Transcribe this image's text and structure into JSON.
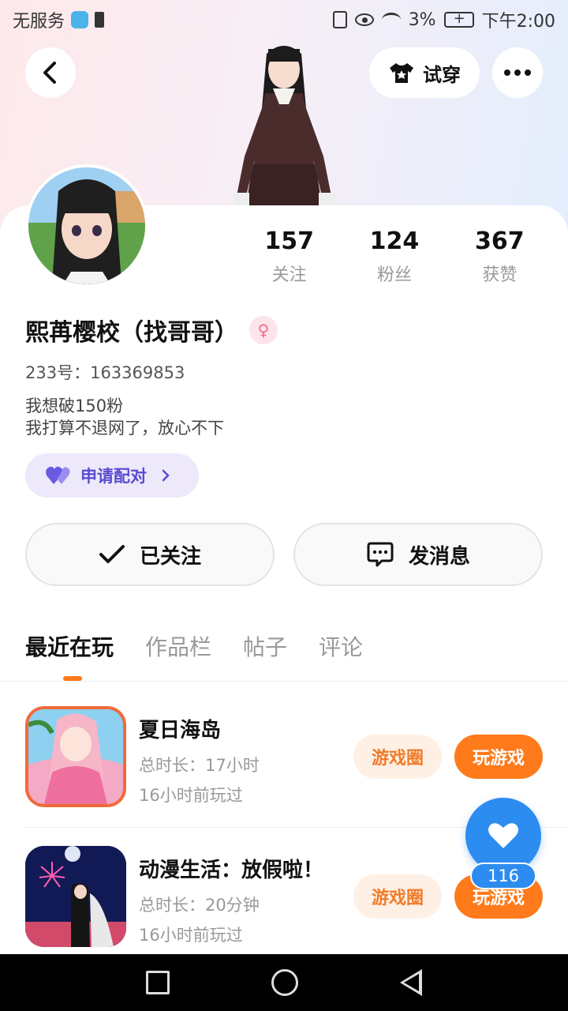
{
  "status_bar": {
    "carrier": "无服务",
    "battery_percent": "3%",
    "time": "下午2:00"
  },
  "header": {
    "tryon_label": "试穿"
  },
  "profile": {
    "stats": [
      {
        "value": "157",
        "label": "关注"
      },
      {
        "value": "124",
        "label": "粉丝"
      },
      {
        "value": "367",
        "label": "获赞"
      }
    ],
    "nickname": "熙苒樱校（找哥哥）",
    "gender_icon": "♀",
    "uid": "233号：163369853",
    "bio_line1": "我想破150粉",
    "bio_line2": "我打算不退网了，放心不下",
    "pair_label": "申请配对"
  },
  "actions": {
    "follow_label": "已关注",
    "message_label": "发消息"
  },
  "tabs": [
    "最近在玩",
    "作品栏",
    "帖子",
    "评论"
  ],
  "games": [
    {
      "title": "夏日海岛",
      "duration": "总时长：17小时",
      "last_played": "16小时前玩过",
      "circle_label": "游戏圈",
      "play_label": "玩游戏"
    },
    {
      "title": "动漫生活：放假啦！",
      "duration": "总时长：20分钟",
      "last_played": "16小时前玩过",
      "circle_label": "游戏圈",
      "play_label": "玩游戏"
    }
  ],
  "floating_like": {
    "count": "116"
  },
  "colors": {
    "accent_orange": "#ff7a1a",
    "accent_blue": "#2d8cf0",
    "pair_purple": "#5a4bd0"
  }
}
